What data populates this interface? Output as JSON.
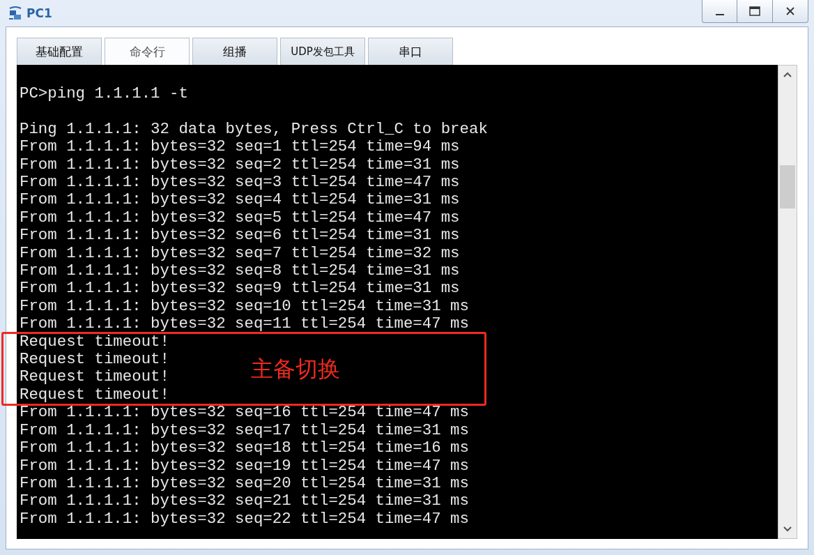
{
  "window": {
    "title": "PC1"
  },
  "tabs": [
    {
      "label": "基础配置",
      "selected": false
    },
    {
      "label": "命令行",
      "selected": true
    },
    {
      "label": "组播",
      "selected": false
    },
    {
      "label": "UDP发包工具",
      "selected": false
    },
    {
      "label": "串口",
      "selected": false
    }
  ],
  "terminal": {
    "blocks": [
      {
        "lines": [
          "PC>ping 1.1.1.1 -t"
        ]
      },
      {
        "lines": [
          "Ping 1.1.1.1: 32 data bytes, Press Ctrl_C to break",
          "From 1.1.1.1: bytes=32 seq=1 ttl=254 time=94 ms",
          "From 1.1.1.1: bytes=32 seq=2 ttl=254 time=31 ms",
          "From 1.1.1.1: bytes=32 seq=3 ttl=254 time=47 ms",
          "From 1.1.1.1: bytes=32 seq=4 ttl=254 time=31 ms",
          "From 1.1.1.1: bytes=32 seq=5 ttl=254 time=47 ms",
          "From 1.1.1.1: bytes=32 seq=6 ttl=254 time=31 ms",
          "From 1.1.1.1: bytes=32 seq=7 ttl=254 time=32 ms",
          "From 1.1.1.1: bytes=32 seq=8 ttl=254 time=31 ms",
          "From 1.1.1.1: bytes=32 seq=9 ttl=254 time=31 ms",
          "From 1.1.1.1: bytes=32 seq=10 ttl=254 time=31 ms",
          "From 1.1.1.1: bytes=32 seq=11 ttl=254 time=47 ms",
          "Request timeout!",
          "Request timeout!",
          "Request timeout!",
          "Request timeout!",
          "From 1.1.1.1: bytes=32 seq=16 ttl=254 time=47 ms",
          "From 1.1.1.1: bytes=32 seq=17 ttl=254 time=31 ms",
          "From 1.1.1.1: bytes=32 seq=18 ttl=254 time=16 ms",
          "From 1.1.1.1: bytes=32 seq=19 ttl=254 time=47 ms",
          "From 1.1.1.1: bytes=32 seq=20 ttl=254 time=31 ms",
          "From 1.1.1.1: bytes=32 seq=21 ttl=254 time=31 ms",
          "From 1.1.1.1: bytes=32 seq=22 ttl=254 time=47 ms"
        ]
      }
    ]
  },
  "annotation": {
    "label": "主备切换"
  }
}
